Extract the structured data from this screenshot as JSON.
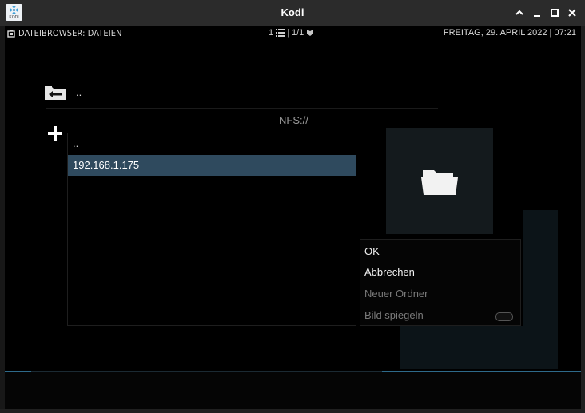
{
  "window": {
    "title": "Kodi",
    "app_logo_text": "KODI",
    "icons": {
      "logo": "kodi-logo-icon",
      "maximize": "chevron-up-icon",
      "minimize": "minimize-icon",
      "restore": "restore-icon",
      "close": "close-icon"
    }
  },
  "header": {
    "section": "DATEIBROWSER: DATEIEN",
    "count": "1",
    "pages": "1/1",
    "datetime": "FREITAG, 29. APRIL 2022 | 07:21",
    "icons": {
      "section": "folder-small-icon",
      "list": "list-icon",
      "sort": "shield-sort-icon"
    }
  },
  "browser": {
    "up_label": "..",
    "path": "NFS://",
    "items": [
      {
        "label": ".."
      },
      {
        "label": "192.168.1.175"
      }
    ],
    "icons": {
      "back": "back-folder-icon",
      "add": "plus-icon",
      "thumb": "folder-icon"
    }
  },
  "context_menu": {
    "items": [
      {
        "label": "OK",
        "enabled": true
      },
      {
        "label": "Abbrechen",
        "enabled": true
      },
      {
        "label": "Neuer Ordner",
        "enabled": false
      },
      {
        "label": "Bild spiegeln",
        "enabled": false,
        "toggle": false
      }
    ]
  },
  "colors": {
    "accent": "#2f4a5e",
    "background": "#000000",
    "titlebar": "#2b2b2b"
  }
}
